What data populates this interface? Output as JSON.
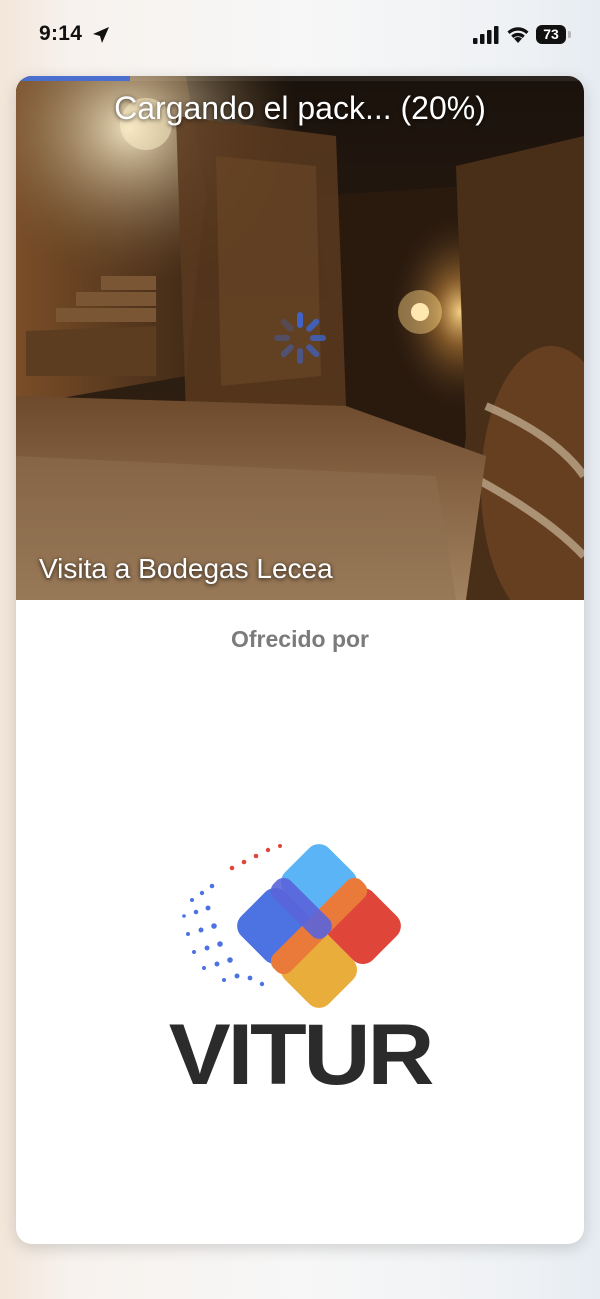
{
  "status_bar": {
    "time": "9:14",
    "battery_level": "73"
  },
  "loader": {
    "text": "Cargando el pack... (20%)",
    "progress": 0.2
  },
  "tour": {
    "title": "Visita a Bodegas Lecea"
  },
  "sponsor": {
    "label": "Ofrecido por",
    "brand": "VITUR"
  },
  "colors": {
    "progress": "#4a6fcf",
    "logo_red": "#e0453a",
    "logo_orange": "#ea7a3a",
    "logo_yellow": "#e9ad3c",
    "logo_light_blue": "#5ab4f5",
    "logo_blue": "#4d72e2",
    "logo_dark_blue": "#5a64da"
  },
  "icons": [
    "location-arrow-icon",
    "cellular-signal-icon",
    "wifi-icon",
    "battery-icon",
    "loading-spinner-icon"
  ]
}
